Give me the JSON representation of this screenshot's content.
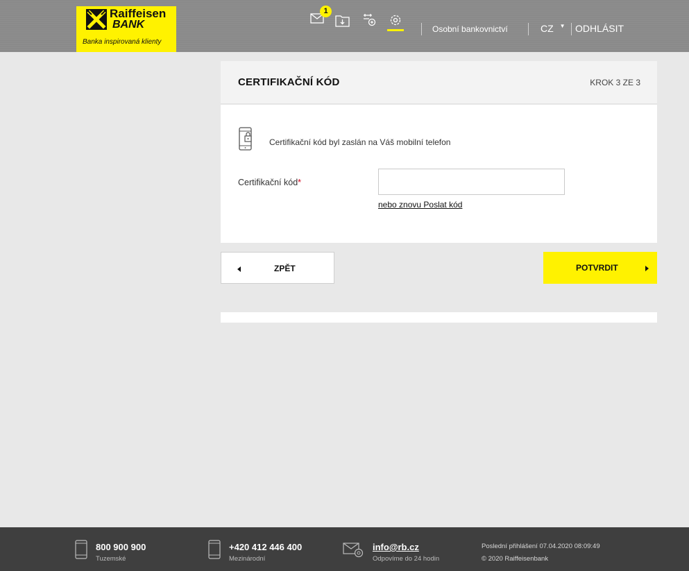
{
  "header": {
    "logo": {
      "name_line1": "Raiffeisen",
      "name_line2": "BANK",
      "tagline": "Banka inspirovaná klienty"
    },
    "messages_badge": "1",
    "icons": [
      "envelope-icon",
      "download-folder-icon",
      "gear-lock-icon",
      "settings-gear-icon"
    ],
    "nav_link": "Osobní bankovnictví",
    "language": "CZ",
    "logout": "ODHLÁSIT"
  },
  "card": {
    "title": "CERTIFIKAČNÍ KÓD",
    "step": "KROK 3 ZE 3",
    "info_text": "Certifikační kód byl zaslán na Váš mobilní telefon",
    "field_label": "Certifikační kód",
    "required_mark": "*",
    "input_value": "",
    "resend_link": "nebo znovu Poslat kód"
  },
  "buttons": {
    "back": "ZPĚT",
    "confirm": "POTVRDIT"
  },
  "footer": {
    "phone_domestic": "800 900 900",
    "phone_domestic_label": "Tuzemské",
    "phone_international": "+420 412 446 400",
    "phone_international_label": "Mezinárodní",
    "email": "info@rb.cz",
    "email_label": "Odpovíme do 24 hodin",
    "last_login": "Poslední přihlášení 07.04.2020   08:09:49",
    "copyright": "© 2020 Raiffeisenbank"
  },
  "colors": {
    "brand_yellow": "#fff200",
    "header_gray": "#8a8a8a",
    "footer_dark": "#3f3f3f",
    "required_red": "#d0021b"
  }
}
